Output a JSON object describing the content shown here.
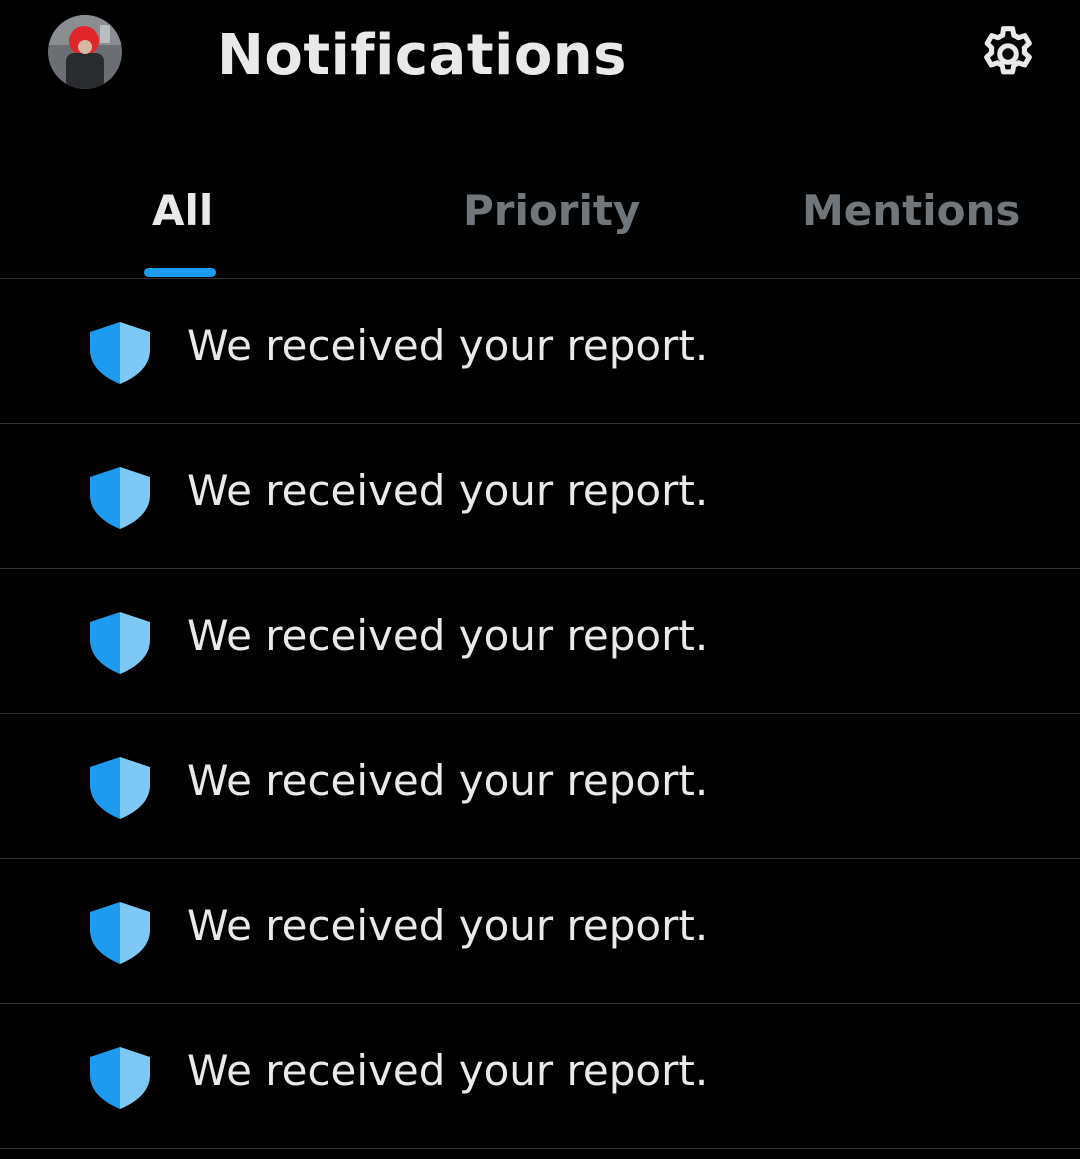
{
  "header": {
    "title": "Notifications",
    "avatar_icon": "user-avatar",
    "settings_icon": "gear-icon"
  },
  "tabs": [
    {
      "label": "All",
      "selected": true
    },
    {
      "label": "Priority",
      "selected": false
    },
    {
      "label": "Mentions",
      "selected": false
    }
  ],
  "notifications": [
    {
      "icon": "shield-icon",
      "text": "We received your report."
    },
    {
      "icon": "shield-icon",
      "text": "We received your report."
    },
    {
      "icon": "shield-icon",
      "text": "We received your report."
    },
    {
      "icon": "shield-icon",
      "text": "We received your report."
    },
    {
      "icon": "shield-icon",
      "text": "We received your report."
    },
    {
      "icon": "shield-icon",
      "text": "We received your report."
    }
  ],
  "colors": {
    "background": "#000000",
    "accent": "#1d9bf0",
    "shield_dark": "#1d9bf0",
    "shield_light": "#7ec8f5",
    "text_primary": "#e7e9ea",
    "text_secondary": "#71767b",
    "divider": "#2f3336"
  }
}
